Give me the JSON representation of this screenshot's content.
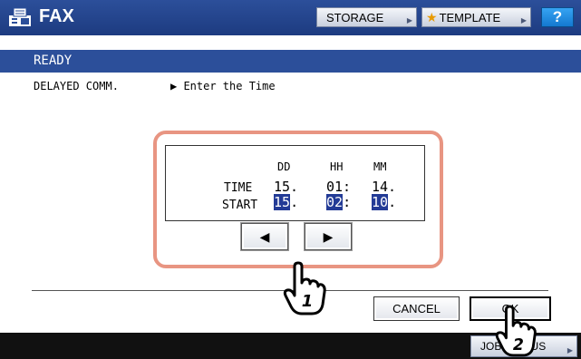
{
  "header": {
    "title": "FAX",
    "storage_label": "STORAGE",
    "template_label": "TEMPLATE",
    "help_label": "?"
  },
  "status": {
    "text": "READY",
    "function_label": "DELAYED COMM.",
    "prompt": "▶ Enter the Time"
  },
  "time_panel": {
    "headers": [
      "DD",
      "HH",
      "MM"
    ],
    "time_label": "TIME",
    "time_values": [
      "15.",
      "01:",
      "14."
    ],
    "start_label": "START",
    "start_values": [
      "15",
      "02",
      "10"
    ],
    "start_separators": [
      ".",
      ":",
      "."
    ]
  },
  "nav": {
    "left_arrow": "◀",
    "right_arrow": "▶"
  },
  "buttons": {
    "cancel": "CANCEL",
    "ok": "OK",
    "job_status": "JOB STATUS"
  },
  "callouts": {
    "step1": "1",
    "step2": "2"
  },
  "icons": [
    "fax-icon",
    "star-icon",
    "left-arrow-icon",
    "right-arrow-icon",
    "hand-pointer-icon"
  ]
}
